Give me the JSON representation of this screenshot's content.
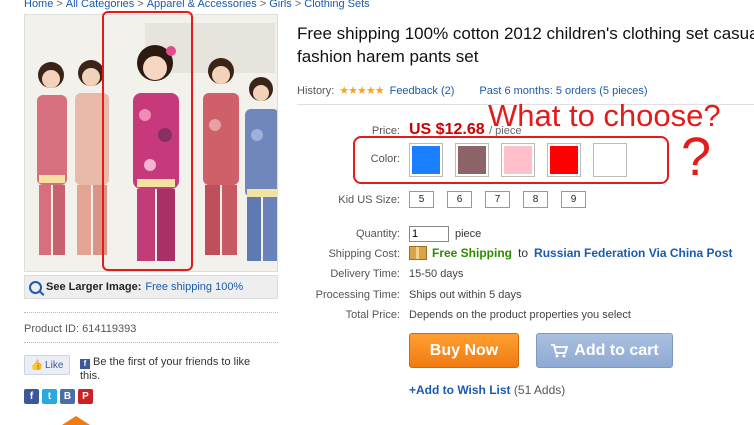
{
  "breadcrumb": [
    "Home",
    "All Categories",
    "Apparel & Accessories",
    "Girls",
    "Clothing Sets"
  ],
  "breadcrumb_sep": ">",
  "gallery": {
    "larger_label": "See Larger Image:",
    "larger_link": "Free shipping 100%",
    "product_id_label": "Product ID:",
    "product_id": "614119393"
  },
  "social": {
    "like_label": "Like",
    "like_text": "Be the first of your friends to like this.",
    "share_icons": [
      "facebook-icon",
      "twitter-icon",
      "blogger-icon",
      "pinterest-icon"
    ]
  },
  "product": {
    "title": "Free shipping 100% cotton 2012 children's clothing set casual fashion harem pants set",
    "history_label": "History:",
    "feedback": "Feedback (2)",
    "past_orders": "Past 6 months: 5 orders (5 pieces)",
    "price_label": "Price:",
    "price": "US $12.68",
    "price_unit": "/ piece",
    "color_label": "Color:",
    "colors": [
      "#1a7fff",
      "#8c6468",
      "#ffc0cb",
      "#ff0000",
      "#ffffff"
    ],
    "size_label": "Kid US Size:",
    "sizes": [
      "5",
      "6",
      "7",
      "8",
      "9"
    ],
    "quantity_label": "Quantity:",
    "quantity": "1",
    "quantity_unit": "piece",
    "shipping_label": "Shipping Cost:",
    "shipping_free": "Free Shipping",
    "shipping_to": "to",
    "shipping_dest": "Russian Federation Via China Post",
    "delivery_label": "Delivery Time:",
    "delivery": "15-50 days",
    "processing_label": "Processing Time:",
    "processing": "Ships out within 5 days",
    "total_label": "Total Price:",
    "total": "Depends on the product properties you select",
    "buy_now": "Buy Now",
    "add_to_cart": "Add to cart",
    "wishlist": "+Add to Wish List",
    "wishlist_count": "(51 Adds)"
  },
  "annotation": {
    "text": "What to choose?",
    "mark": "?",
    "color": "#e31b1b"
  },
  "colors_theme": {
    "link": "#1a5ab0",
    "price": "#cc0000",
    "buy": "#f07b12",
    "cart": "#8ea9d3",
    "free_shipping": "#2e8b00"
  }
}
